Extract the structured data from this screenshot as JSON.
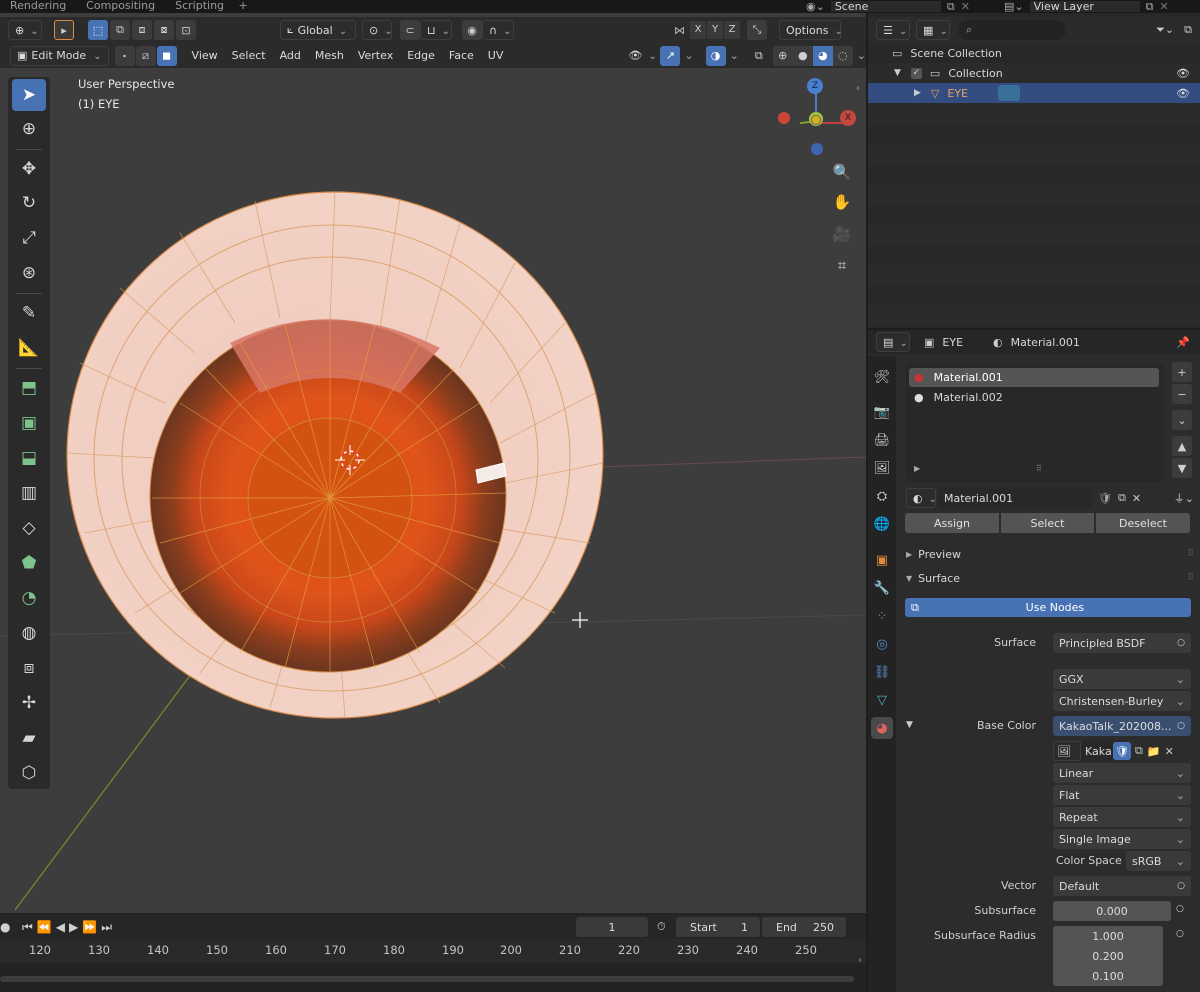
{
  "workspace_tabs": [
    "Rendering",
    "Compositing",
    "Scripting"
  ],
  "workspace_add": "+",
  "scene": {
    "icon": "scene-icon",
    "name": "Scene"
  },
  "view_layer": {
    "name": "View Layer"
  },
  "viewport_header": {
    "transform_orientation": "Global",
    "axis_x": "X",
    "axis_y": "Y",
    "axis_z": "Z",
    "options_label": "Options",
    "mode": "Edit Mode",
    "menus": [
      "View",
      "Select",
      "Add",
      "Mesh",
      "Vertex",
      "Edge",
      "Face",
      "UV"
    ]
  },
  "viewport": {
    "perspective_label": "User Perspective",
    "object_label": "(1) EYE",
    "gizmo": {
      "z_label": "Z",
      "x_label": "X"
    }
  },
  "timeline": {
    "current_frame": "1",
    "start_label": "Start",
    "start_value": "1",
    "end_label": "End",
    "end_value": "250",
    "ruler": [
      "120",
      "130",
      "140",
      "150",
      "160",
      "170",
      "180",
      "190",
      "200",
      "210",
      "220",
      "230",
      "240",
      "250"
    ]
  },
  "outliner": {
    "search_placeholder": "",
    "scene_collection": "Scene Collection",
    "collection": "Collection",
    "object": "EYE"
  },
  "properties": {
    "object_name": "EYE",
    "material_name": "Material.001",
    "slots": [
      "Material.001",
      "Material.002"
    ],
    "active_material": "Material.001",
    "assign_label": "Assign",
    "select_label": "Select",
    "deselect_label": "Deselect",
    "preview_panel": "Preview",
    "surface_panel": "Surface",
    "use_nodes_label": "Use Nodes",
    "surface_label": "Surface",
    "surface_value": "Principled BSDF",
    "distribution": "GGX",
    "subsurface_method": "Christensen-Burley",
    "base_color_label": "Base Color",
    "base_color_value": "KakaoTalk_202008...",
    "image_name": "Kaka",
    "interpolation": "Linear",
    "projection": "Flat",
    "extension": "Repeat",
    "source": "Single Image",
    "color_space_label": "Color Space",
    "color_space_value": "sRGB",
    "vector_label": "Vector",
    "vector_value": "Default",
    "subsurface_label": "Subsurface",
    "subsurface_value": "0.000",
    "subsurface_radius_label": "Subsurface Radius",
    "subsurface_radius": [
      "1.000",
      "0.200",
      "0.100"
    ]
  },
  "colors": {
    "accent": "#4772b3",
    "selection_orange": "#e8a25a",
    "iris_orange": "#d9501a"
  }
}
